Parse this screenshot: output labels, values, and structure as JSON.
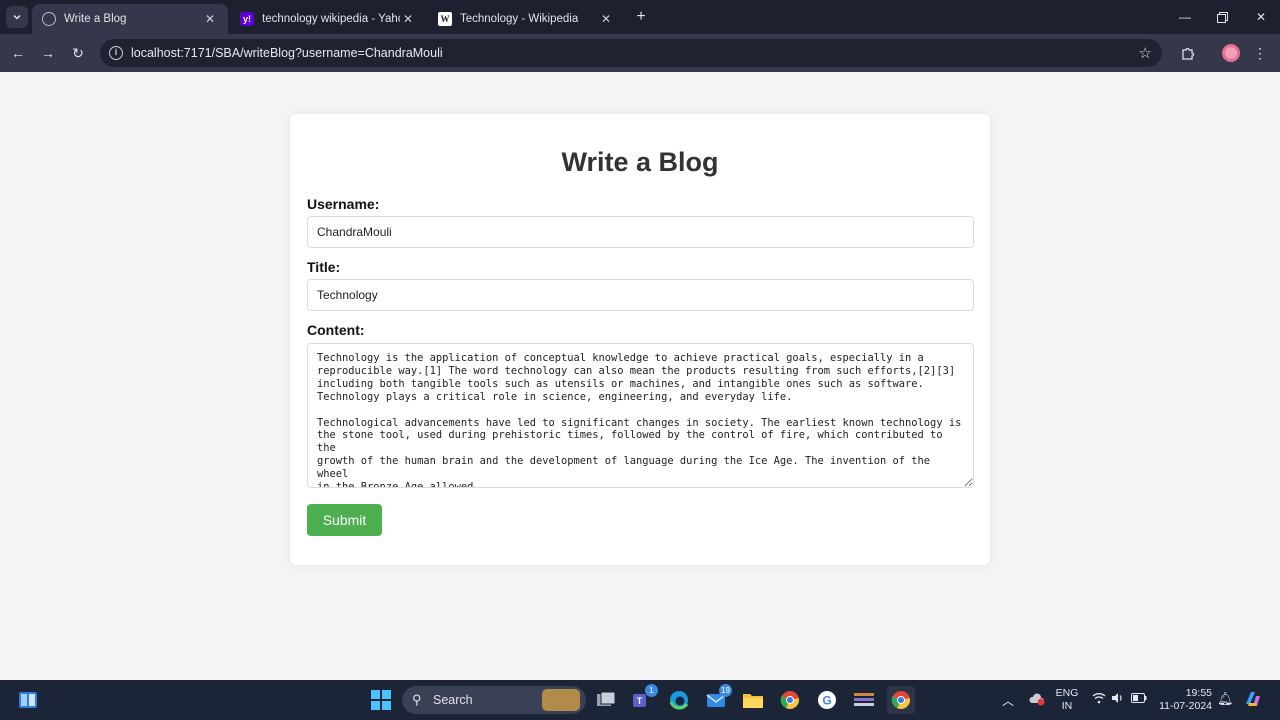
{
  "browser": {
    "tabs": [
      {
        "title": "Write a Blog",
        "active": true,
        "icon": "globe-icon"
      },
      {
        "title": "technology wikipedia - Yahoo Ir",
        "active": false,
        "icon": "yahoo-icon"
      },
      {
        "title": "Technology - Wikipedia",
        "active": false,
        "icon": "wikipedia-icon"
      }
    ],
    "url": "localhost:7171/SBA/writeBlog?username=ChandraMouli",
    "tab_colors": {
      "bar": "#1e1f2f",
      "active": "#35374b"
    }
  },
  "form": {
    "heading": "Write a Blog",
    "username_label": "Username:",
    "username_value": "ChandraMouli",
    "title_label": "Title:",
    "title_value": "Technology",
    "content_label": "Content:",
    "content_value": "Technology is the application of conceptual knowledge to achieve practical goals, especially in a\nreproducible way.[1] The word technology can also mean the products resulting from such efforts,[2][3]\nincluding both tangible tools such as utensils or machines, and intangible ones such as software.\nTechnology plays a critical role in science, engineering, and everyday life.\n\nTechnological advancements have led to significant changes in society. The earliest known technology is\nthe stone tool, used during prehistoric times, followed by the control of fire, which contributed to the\ngrowth of the human brain and the development of language during the Ice Age. The invention of the wheel\nin the Bronze Age allowed",
    "submit_label": "Submit",
    "submit_color": "#4caf50"
  },
  "taskbar": {
    "search_label": "Search",
    "teams_badge": "1",
    "mail_badge": "19",
    "language_line1": "ENG",
    "language_line2": "IN",
    "time": "19:55",
    "date": "11-07-2024"
  }
}
